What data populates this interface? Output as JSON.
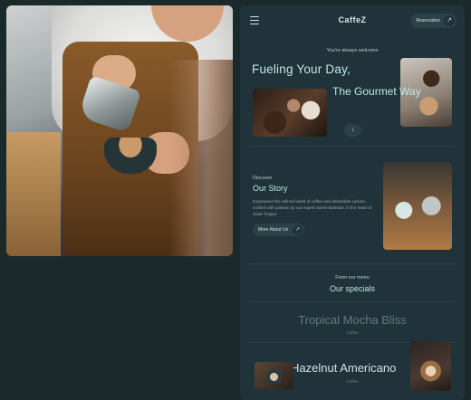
{
  "header": {
    "brand": "CaffeZ",
    "reservation_label": "Reservation",
    "arrow_glyph": "↗"
  },
  "hero": {
    "welcome": "You're always welcome",
    "title_line1": "Fueling Your Day,",
    "title_line2": "The Gourmet Way",
    "scroll_glyph": "↓"
  },
  "story": {
    "eyebrow": "Discover",
    "title": "Our Story",
    "body": "Experience the refined world of coffee and delectable cuisine, crafted with passion by our expert owner-Baristas, in the heart of Saint-Tropez.",
    "button_label": "More About Us",
    "arrow_glyph": "↗"
  },
  "menu": {
    "eyebrow": "From our menu",
    "title": "Our specials",
    "items": [
      {
        "name": "Tropical Mocha Bliss",
        "category": "Coffee"
      },
      {
        "name": "Hazelnut Americano",
        "category": "Coffee"
      }
    ]
  },
  "icons": {
    "menu": "hamburger-menu-icon",
    "arrow": "arrow-up-right-icon",
    "down": "arrow-down-icon"
  }
}
